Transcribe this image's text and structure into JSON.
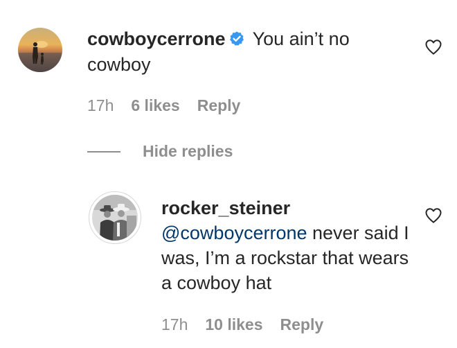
{
  "comment": {
    "username": "cowboycerrone",
    "verified": true,
    "text": "You ain’t no cowboy",
    "time": "17h",
    "likes": "6 likes",
    "reply_label": "Reply"
  },
  "hide_replies_label": "Hide replies",
  "reply": {
    "username": "rocker_steiner",
    "mention": "@cowboycerrone",
    "text": " never said I was, I’m a rockstar that wears a cowboy hat",
    "time": "17h",
    "likes": "10 likes",
    "reply_label": "Reply"
  },
  "icons": {
    "like": "heart-outline-icon",
    "verified": "verified-badge-icon"
  },
  "colors": {
    "text": "#262626",
    "secondary": "#8e8e8e",
    "mention": "#00376b",
    "verified": "#3897f0"
  }
}
